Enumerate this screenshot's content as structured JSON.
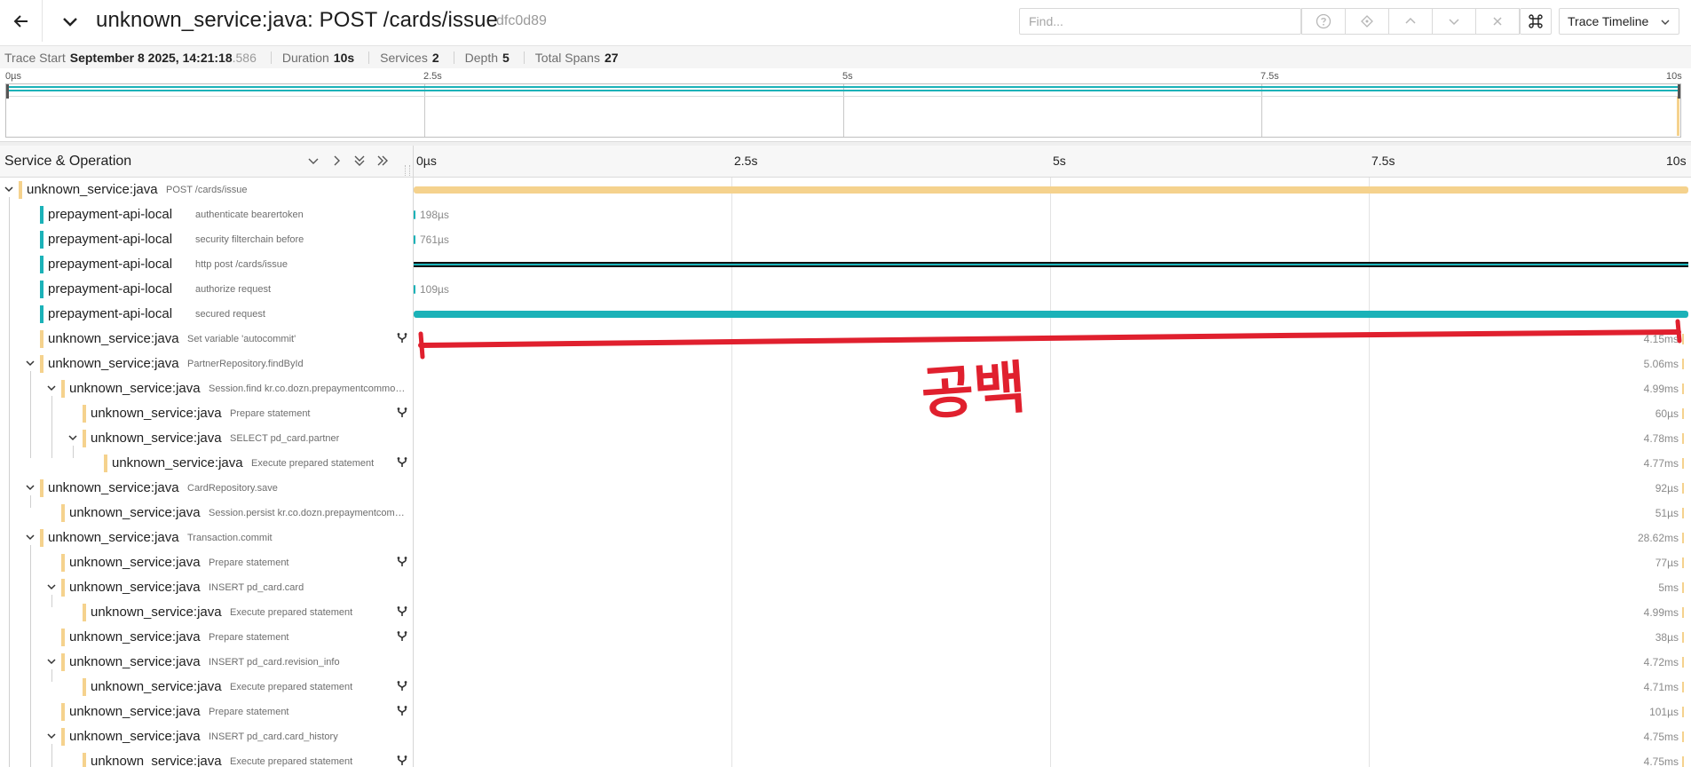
{
  "header": {
    "title": "unknown_service:java: POST /cards/issue",
    "trace_id": "dfc0d89",
    "find_placeholder": "Find...",
    "view_select": "Trace Timeline"
  },
  "summary": {
    "trace_start_label": "Trace Start",
    "trace_start_value": "September 8 2025, 14:21:18",
    "trace_start_ms": ".586",
    "duration_label": "Duration",
    "duration_value": "10s",
    "services_label": "Services",
    "services_value": "2",
    "depth_label": "Depth",
    "depth_value": "5",
    "total_spans_label": "Total Spans",
    "total_spans_value": "27"
  },
  "minimap": {
    "ticks": [
      "0µs",
      "2.5s",
      "5s",
      "7.5s",
      "10s"
    ]
  },
  "timeline": {
    "column_title": "Service & Operation",
    "ticks": [
      "0µs",
      "2.5s",
      "5s",
      "7.5s",
      "10s"
    ]
  },
  "colors": {
    "gold": "#f5d28d",
    "teal": "#1bb2b8",
    "black": "#111111",
    "annotation_red": "#e0202e"
  },
  "annotation_text": "공백",
  "spans": [
    {
      "svc": "unknown_service:java",
      "op": "POST /cards/issue",
      "depth": 0,
      "caret": true,
      "color": "gold",
      "dur": "",
      "fork": false,
      "bar": [
        0,
        1.0
      ]
    },
    {
      "svc": "prepayment-api-local",
      "op": "authenticate bearertoken",
      "depth": 1,
      "caret": false,
      "color": "teal",
      "dur": "198µs",
      "fork": false,
      "bar": [
        0,
        0.0015
      ],
      "dur_pos": "after"
    },
    {
      "svc": "prepayment-api-local",
      "op": "security filterchain before",
      "depth": 1,
      "caret": false,
      "color": "teal",
      "dur": "761µs",
      "fork": false,
      "bar": [
        0,
        0.0015
      ],
      "dur_pos": "after"
    },
    {
      "svc": "prepayment-api-local",
      "op": "http post /cards/issue",
      "depth": 1,
      "caret": false,
      "color": "teal",
      "dur": "",
      "fork": false,
      "bar": [
        0,
        1.0
      ],
      "black": true
    },
    {
      "svc": "prepayment-api-local",
      "op": "authorize request",
      "depth": 1,
      "caret": false,
      "color": "teal",
      "dur": "109µs",
      "fork": false,
      "bar": [
        0,
        0.0015
      ],
      "dur_pos": "after"
    },
    {
      "svc": "prepayment-api-local",
      "op": "secured request",
      "depth": 1,
      "caret": false,
      "color": "teal",
      "dur": "",
      "fork": false,
      "bar": [
        0,
        1.0
      ]
    },
    {
      "svc": "unknown_service:java",
      "op": "Set variable 'autocommit'",
      "depth": 1,
      "caret": false,
      "color": "gold",
      "dur": "4.15ms",
      "fork": true,
      "bar": null
    },
    {
      "svc": "unknown_service:java",
      "op": "PartnerRepository.findById",
      "depth": 1,
      "caret": true,
      "color": "gold",
      "dur": "5.06ms",
      "fork": false,
      "bar": null
    },
    {
      "svc": "unknown_service:java",
      "op": "Session.find kr.co.dozn.prepaymentcommon...",
      "depth": 2,
      "caret": true,
      "color": "gold",
      "dur": "4.99ms",
      "fork": false,
      "bar": null
    },
    {
      "svc": "unknown_service:java",
      "op": "Prepare statement",
      "depth": 3,
      "caret": false,
      "color": "gold",
      "dur": "60µs",
      "fork": true,
      "bar": null
    },
    {
      "svc": "unknown_service:java",
      "op": "SELECT pd_card.partner",
      "depth": 3,
      "caret": true,
      "color": "gold",
      "dur": "4.78ms",
      "fork": false,
      "bar": null
    },
    {
      "svc": "unknown_service:java",
      "op": "Execute prepared statement",
      "depth": 4,
      "caret": false,
      "color": "gold",
      "dur": "4.77ms",
      "fork": true,
      "bar": null
    },
    {
      "svc": "unknown_service:java",
      "op": "CardRepository.save",
      "depth": 1,
      "caret": true,
      "color": "gold",
      "dur": "92µs",
      "fork": false,
      "bar": null
    },
    {
      "svc": "unknown_service:java",
      "op": "Session.persist kr.co.dozn.prepaymentcomm...",
      "depth": 2,
      "caret": false,
      "color": "gold",
      "dur": "51µs",
      "fork": false,
      "bar": null
    },
    {
      "svc": "unknown_service:java",
      "op": "Transaction.commit",
      "depth": 1,
      "caret": true,
      "color": "gold",
      "dur": "28.62ms",
      "fork": false,
      "bar": null
    },
    {
      "svc": "unknown_service:java",
      "op": "Prepare statement",
      "depth": 2,
      "caret": false,
      "color": "gold",
      "dur": "77µs",
      "fork": true,
      "bar": null
    },
    {
      "svc": "unknown_service:java",
      "op": "INSERT pd_card.card",
      "depth": 2,
      "caret": true,
      "color": "gold",
      "dur": "5ms",
      "fork": false,
      "bar": null
    },
    {
      "svc": "unknown_service:java",
      "op": "Execute prepared statement",
      "depth": 3,
      "caret": false,
      "color": "gold",
      "dur": "4.99ms",
      "fork": true,
      "bar": null
    },
    {
      "svc": "unknown_service:java",
      "op": "Prepare statement",
      "depth": 2,
      "caret": false,
      "color": "gold",
      "dur": "38µs",
      "fork": true,
      "bar": null
    },
    {
      "svc": "unknown_service:java",
      "op": "INSERT pd_card.revision_info",
      "depth": 2,
      "caret": true,
      "color": "gold",
      "dur": "4.72ms",
      "fork": false,
      "bar": null
    },
    {
      "svc": "unknown_service:java",
      "op": "Execute prepared statement",
      "depth": 3,
      "caret": false,
      "color": "gold",
      "dur": "4.71ms",
      "fork": true,
      "bar": null
    },
    {
      "svc": "unknown_service:java",
      "op": "Prepare statement",
      "depth": 2,
      "caret": false,
      "color": "gold",
      "dur": "101µs",
      "fork": true,
      "bar": null
    },
    {
      "svc": "unknown_service:java",
      "op": "INSERT pd_card.card_history",
      "depth": 2,
      "caret": true,
      "color": "gold",
      "dur": "4.75ms",
      "fork": false,
      "bar": null
    },
    {
      "svc": "unknown_service:java",
      "op": "Execute prepared statement",
      "depth": 3,
      "caret": false,
      "color": "gold",
      "dur": "4.75ms",
      "fork": true,
      "bar": null
    }
  ]
}
